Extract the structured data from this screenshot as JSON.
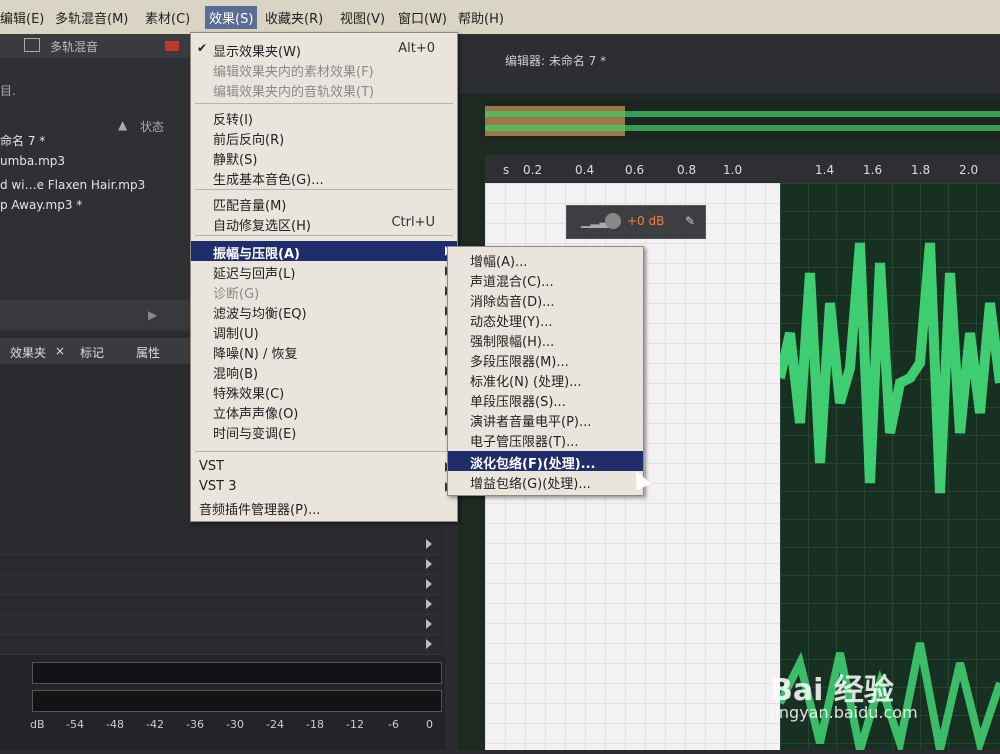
{
  "menubar": {
    "items": [
      "编辑(E)",
      "多轨混音(M)",
      "素材(C)",
      "效果(S)",
      "收藏夹(R)",
      "视图(V)",
      "窗口(W)",
      "帮助(H)"
    ]
  },
  "toolbar2": {
    "label": "多轨混音"
  },
  "files_panel": {
    "header_status": "状态",
    "partial_line": "目.",
    "files": [
      "命名 7 *",
      "umba.mp3",
      "d wi…e Flaxen Hair.mp3",
      "p Away.mp3 *"
    ]
  },
  "tabs": [
    "效果夹",
    "标记",
    "属性"
  ],
  "editor": {
    "title": "编辑器: 未命名 7 *"
  },
  "ruler_ticks": [
    "s",
    "0.2",
    "0.4",
    "0.6",
    "0.8",
    "1.0",
    "1.4",
    "1.6",
    "1.8",
    "2.0"
  ],
  "hud": {
    "value": "+0 dB"
  },
  "meter_scale": [
    "dB",
    "-54",
    "-48",
    "-42",
    "-36",
    "-30",
    "-24",
    "-18",
    "-12",
    "-6",
    "0"
  ],
  "effects_menu": {
    "items": [
      {
        "label": "显示效果夹(W)",
        "shortcut": "Alt+0",
        "checked": true
      },
      {
        "label": "编辑效果夹内的素材效果(F)",
        "disabled": true
      },
      {
        "label": "编辑效果夹内的音轨效果(T)",
        "disabled": true
      },
      {
        "label": "反转(I)"
      },
      {
        "label": "前后反向(R)"
      },
      {
        "label": "静默(S)"
      },
      {
        "label": "生成基本音色(G)..."
      },
      {
        "label": "匹配音量(M)"
      },
      {
        "label": "自动修复选区(H)",
        "shortcut": "Ctrl+U"
      },
      {
        "label": "振幅与压限(A)",
        "submenu": true,
        "highlight": true
      },
      {
        "label": "延迟与回声(L)",
        "submenu": true
      },
      {
        "label": "诊断(G)",
        "submenu": true
      },
      {
        "label": "滤波与均衡(EQ)",
        "submenu": true
      },
      {
        "label": "调制(U)",
        "submenu": true
      },
      {
        "label": "降噪(N) / 恢复",
        "submenu": true
      },
      {
        "label": "混响(B)",
        "submenu": true
      },
      {
        "label": "特殊效果(C)",
        "submenu": true
      },
      {
        "label": "立体声声像(O)",
        "submenu": true
      },
      {
        "label": "时间与变调(E)",
        "submenu": true
      },
      {
        "label": "VST",
        "submenu": true
      },
      {
        "label": "VST 3",
        "submenu": true
      },
      {
        "label": "音频插件管理器(P)..."
      }
    ]
  },
  "amp_submenu": {
    "items": [
      {
        "label": "增幅(A)..."
      },
      {
        "label": "声道混合(C)..."
      },
      {
        "label": "消除齿音(D)..."
      },
      {
        "label": "动态处理(Y)..."
      },
      {
        "label": "强制限幅(H)..."
      },
      {
        "label": "多段压限器(M)..."
      },
      {
        "label": "标准化(N) (处理)..."
      },
      {
        "label": "单段压限器(S)..."
      },
      {
        "label": "演讲者音量电平(P)..."
      },
      {
        "label": "电子管压限器(T)..."
      },
      {
        "label": "淡化包络(F)(处理)...",
        "highlight": true
      },
      {
        "label": "增益包络(G)(处理)..."
      }
    ]
  },
  "watermark": {
    "logo": "Bai 经验",
    "url": "jingyan.baidu.com"
  }
}
